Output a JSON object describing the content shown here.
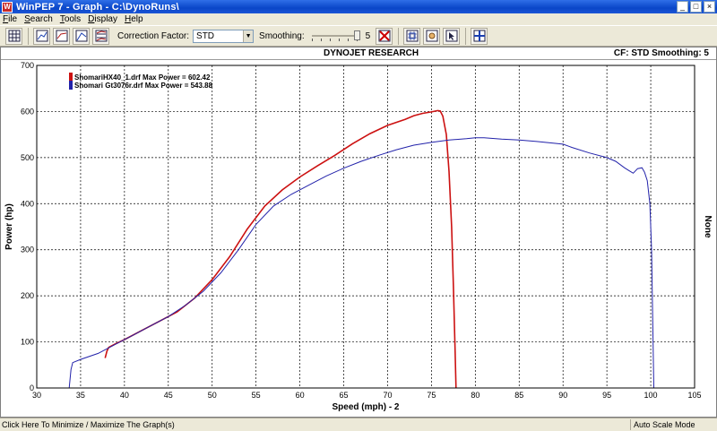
{
  "window": {
    "title": "WinPEP 7  -  Graph - C:\\DynoRuns\\"
  },
  "menu": [
    "File",
    "Search",
    "Tools",
    "Display",
    "Help"
  ],
  "toolbar": {
    "correction_label": "Correction Factor:",
    "correction_value": "STD",
    "smoothing_label": "Smoothing:",
    "smoothing_value": "5"
  },
  "graph": {
    "title": "DYNOJET RESEARCH",
    "info": "CF: STD   Smoothing: 5",
    "right_axis_label": "None"
  },
  "status": {
    "left": "Click Here To Minimize / Maximize The Graph(s)",
    "right": "Auto Scale Mode"
  },
  "chart_data": {
    "type": "line",
    "xlabel": "Speed (mph)  -  2",
    "ylabel": "Power (hp)",
    "xlim": [
      30,
      105
    ],
    "ylim": [
      0,
      700
    ],
    "xticks": [
      30,
      35,
      40,
      45,
      50,
      55,
      60,
      65,
      70,
      75,
      80,
      85,
      90,
      95,
      100,
      105
    ],
    "yticks": [
      0,
      100,
      200,
      300,
      400,
      500,
      600,
      700
    ],
    "grid": true,
    "legend": "top-left",
    "series": [
      {
        "name": "ShomariHX40_1.drf Max Power = 602.42",
        "color": "#cc1111",
        "x": [
          37.8,
          38.0,
          38.2,
          39.0,
          40.0,
          42.0,
          44.0,
          46.0,
          48.0,
          50.0,
          52.0,
          54.0,
          56.0,
          58.0,
          60.0,
          62.0,
          64.0,
          66.0,
          68.0,
          70.0,
          72.0,
          73.0,
          74.0,
          75.0,
          75.7,
          76.0,
          76.3,
          76.7,
          77.0,
          77.3,
          77.5,
          77.7,
          77.8
        ],
        "y": [
          65,
          80,
          88,
          96,
          105,
          125,
          145,
          165,
          195,
          235,
          285,
          345,
          395,
          430,
          458,
          482,
          505,
          530,
          552,
          570,
          583,
          591,
          596,
          599,
          602,
          601,
          590,
          550,
          470,
          350,
          220,
          80,
          0
        ]
      },
      {
        "name": "Shomari Gt3076r.drf Max Power = 543.88",
        "color": "#2222aa",
        "x": [
          33.7,
          33.9,
          34.1,
          35.0,
          37.0,
          39.0,
          41.0,
          43.0,
          45.0,
          47.0,
          49.0,
          51.0,
          53.0,
          55.0,
          57.0,
          59.0,
          61.0,
          63.0,
          65.0,
          67.0,
          69.0,
          71.0,
          73.0,
          75.0,
          77.0,
          79.0,
          80.0,
          81.0,
          83.0,
          85.0,
          87.0,
          89.0,
          90.0,
          91.0,
          93.0,
          95.0,
          96.0,
          97.0,
          97.5,
          98.0,
          98.5,
          99.0,
          99.3,
          99.6,
          99.9,
          100.1,
          100.2,
          100.3,
          100.35
        ],
        "y": [
          0,
          40,
          55,
          62,
          75,
          95,
          115,
          135,
          155,
          180,
          210,
          250,
          300,
          355,
          395,
          420,
          440,
          460,
          477,
          492,
          505,
          517,
          527,
          533,
          538,
          541,
          543,
          543,
          540,
          538,
          535,
          531,
          529,
          522,
          510,
          500,
          492,
          478,
          472,
          466,
          476,
          478,
          468,
          450,
          400,
          300,
          180,
          60,
          0
        ]
      }
    ]
  }
}
